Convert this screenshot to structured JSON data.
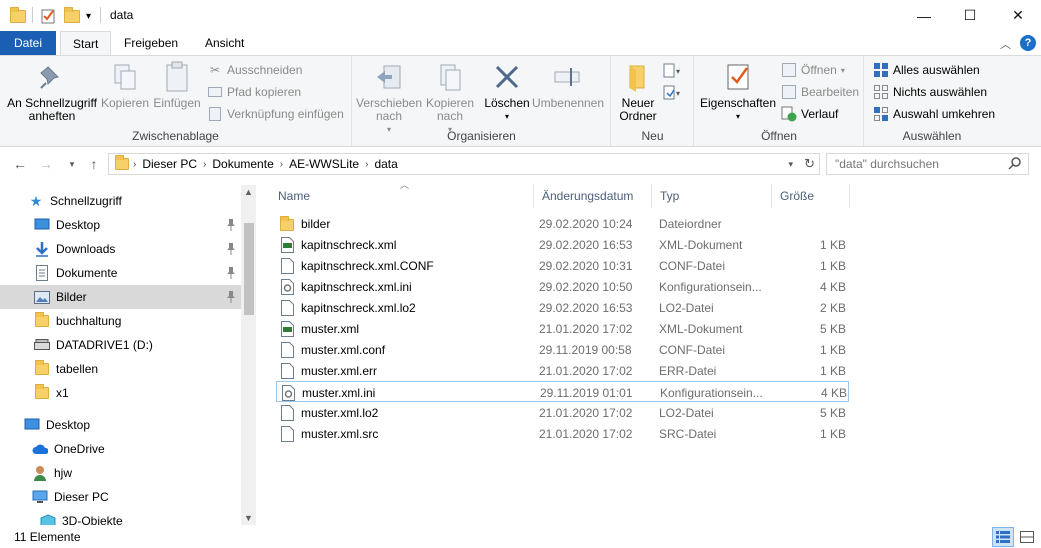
{
  "window": {
    "title": "data",
    "minimize_glyph": "—",
    "maximize_glyph": "☐",
    "close_glyph": "✕"
  },
  "tabs": [
    {
      "label": "Datei"
    },
    {
      "label": "Start"
    },
    {
      "label": "Freigeben"
    },
    {
      "label": "Ansicht"
    }
  ],
  "ribbon": {
    "clipboard": {
      "label": "Zwischenablage",
      "pin_quick_access": "An Schnellzugriff anheften",
      "copy": "Kopieren",
      "paste": "Einfügen",
      "cut": "Ausschneiden",
      "copy_path": "Pfad kopieren",
      "paste_shortcut": "Verknüpfung einfügen"
    },
    "organize": {
      "label": "Organisieren",
      "move_to": "Verschieben nach",
      "copy_to": "Kopieren nach",
      "delete": "Löschen",
      "rename": "Umbenennen"
    },
    "new": {
      "label": "Neu",
      "new_folder": "Neuer Ordner"
    },
    "open": {
      "label": "Öffnen",
      "properties": "Eigenschaften",
      "open": "Öffnen",
      "edit": "Bearbeiten",
      "history": "Verlauf"
    },
    "select": {
      "label": "Auswählen",
      "select_all": "Alles auswählen",
      "select_none": "Nichts auswählen",
      "invert": "Auswahl umkehren"
    }
  },
  "address": {
    "crumbs": [
      "Dieser PC",
      "Dokumente",
      "AE-WWSLite",
      "data"
    ],
    "search_placeholder": "\"data\" durchsuchen"
  },
  "navpane": {
    "items": [
      {
        "label": "Schnellzugriff",
        "icon": "star-icon"
      },
      {
        "label": "Desktop",
        "icon": "desktop-icon"
      },
      {
        "label": "Downloads",
        "icon": "download-icon"
      },
      {
        "label": "Dokumente",
        "icon": "document-icon"
      },
      {
        "label": "Bilder",
        "icon": "pictures-icon"
      },
      {
        "label": "buchhaltung",
        "icon": "folder-icon"
      },
      {
        "label": "DATADRIVE1 (D:)",
        "icon": "drive-icon"
      },
      {
        "label": "tabellen",
        "icon": "folder-icon"
      },
      {
        "label": "x1",
        "icon": "folder-icon"
      },
      {
        "label": "Desktop",
        "icon": "desktop-icon"
      },
      {
        "label": "OneDrive",
        "icon": "cloud-icon"
      },
      {
        "label": "hjw",
        "icon": "user-icon"
      },
      {
        "label": "Dieser PC",
        "icon": "computer-icon"
      },
      {
        "label": "3D-Objekte",
        "icon": "cube-icon"
      }
    ]
  },
  "filelist": {
    "columns": {
      "name": "Name",
      "date": "Änderungsdatum",
      "type": "Typ",
      "size": "Größe"
    },
    "rows": [
      {
        "name": "bilder",
        "date": "29.02.2020 10:24",
        "type": "Dateiordner",
        "size": "",
        "icon": "folder-icon"
      },
      {
        "name": "kapitnschreck.xml",
        "date": "29.02.2020 16:53",
        "type": "XML-Dokument",
        "size": "1 KB",
        "icon": "xml-file-icon"
      },
      {
        "name": "kapitnschreck.xml.CONF",
        "date": "29.02.2020 10:31",
        "type": "CONF-Datei",
        "size": "1 KB",
        "icon": "file-icon"
      },
      {
        "name": "kapitnschreck.xml.ini",
        "date": "29.02.2020 10:50",
        "type": "Konfigurationsein...",
        "size": "4 KB",
        "icon": "ini-file-icon"
      },
      {
        "name": "kapitnschreck.xml.lo2",
        "date": "29.02.2020 16:53",
        "type": "LO2-Datei",
        "size": "2 KB",
        "icon": "file-icon"
      },
      {
        "name": "muster.xml",
        "date": "21.01.2020 17:02",
        "type": "XML-Dokument",
        "size": "5 KB",
        "icon": "xml-file-icon"
      },
      {
        "name": "muster.xml.conf",
        "date": "29.11.2019 00:58",
        "type": "CONF-Datei",
        "size": "1 KB",
        "icon": "file-icon"
      },
      {
        "name": "muster.xml.err",
        "date": "21.01.2020 17:02",
        "type": "ERR-Datei",
        "size": "1 KB",
        "icon": "file-icon"
      },
      {
        "name": "muster.xml.ini",
        "date": "29.11.2019 01:01",
        "type": "Konfigurationsein...",
        "size": "4 KB",
        "icon": "ini-file-icon"
      },
      {
        "name": "muster.xml.lo2",
        "date": "21.01.2020 17:02",
        "type": "LO2-Datei",
        "size": "5 KB",
        "icon": "file-icon"
      },
      {
        "name": "muster.xml.src",
        "date": "21.01.2020 17:02",
        "type": "SRC-Datei",
        "size": "1 KB",
        "icon": "file-icon"
      }
    ]
  },
  "status": {
    "count": "11 Elemente"
  },
  "colors": {
    "file_tab": "#1a5fb4",
    "folder": "#f7d06a",
    "selection": "#d9d9d9",
    "focus_border": "#99c9ef"
  }
}
